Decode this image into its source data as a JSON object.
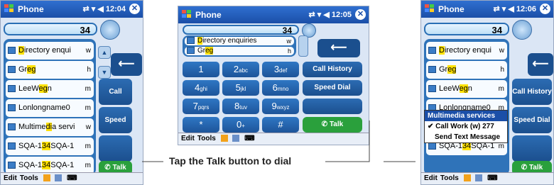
{
  "title": "Phone",
  "left": {
    "time": "12:04",
    "number": "34",
    "items": [
      {
        "pre": "",
        "hl": "D",
        "post": "irectory enqui",
        "tag": "w"
      },
      {
        "pre": "Gr",
        "hl": "eg",
        "post": "",
        "tag": "h"
      },
      {
        "pre": "LeeW",
        "hl": "eg",
        "post": "n",
        "tag": "m"
      },
      {
        "pre": "Lonlongname0",
        "hl": "",
        "post": "",
        "tag": "m"
      },
      {
        "pre": "Multime",
        "hl": "di",
        "post": "a servi",
        "tag": "w"
      },
      {
        "pre": "SQA-1",
        "hl": "34",
        "post": "SQA-1",
        "tag": "m"
      },
      {
        "pre": "SQA-1",
        "hl": "34",
        "post": "SQA-1",
        "tag": "m"
      }
    ],
    "call_history": "Call History",
    "speed_dial": "Speed Dial",
    "talk": "Talk"
  },
  "middle": {
    "time": "12:05",
    "number": "34",
    "items": [
      {
        "pre": "",
        "hl": "D",
        "post": "irectory enquiries",
        "tag": "w"
      },
      {
        "pre": "Gr",
        "hl": "eg",
        "post": "",
        "tag": "h"
      }
    ],
    "keys": [
      {
        "d": "1",
        "l": ""
      },
      {
        "d": "2",
        "l": "abc"
      },
      {
        "d": "3",
        "l": "def"
      },
      {
        "d": "4",
        "l": "ghi"
      },
      {
        "d": "5",
        "l": "jkl"
      },
      {
        "d": "6",
        "l": "mno"
      },
      {
        "d": "7",
        "l": "pqrs"
      },
      {
        "d": "8",
        "l": "tuv"
      },
      {
        "d": "9",
        "l": "wxyz"
      },
      {
        "d": "*",
        "l": ""
      },
      {
        "d": "0",
        "l": "+"
      },
      {
        "d": "#",
        "l": ""
      }
    ],
    "call_history": "Call History",
    "speed_dial": "Speed Dial",
    "talk": "Talk"
  },
  "right": {
    "time": "12:06",
    "number": "34",
    "popup": [
      "Multimedia services",
      "Call Work (w) 277",
      "Send Text Message"
    ],
    "call_history": "Call History",
    "speed_dial": "Speed Dial",
    "talk": "Talk"
  },
  "menu": {
    "edit": "Edit",
    "tools": "Tools"
  },
  "caption": {
    "pre": "Tap the ",
    "bold": "Talk button",
    "post": " to dial"
  },
  "colors": {
    "title_blue": "#1b4fa8",
    "list_blue": "#2f73b9",
    "highlight": "#ffe100",
    "talk_green": "#2aa03c"
  }
}
